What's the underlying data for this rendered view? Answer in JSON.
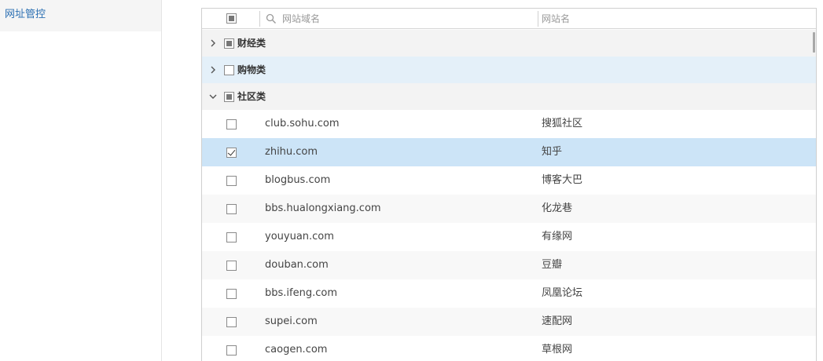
{
  "sidebar": {
    "items": [
      {
        "label": "网址管控"
      }
    ]
  },
  "table": {
    "columns": {
      "domain_placeholder": "网站域名",
      "name_header": "网站名"
    },
    "groups": [
      {
        "name": "财经类",
        "expanded": false,
        "check_state": "partial"
      },
      {
        "name": "购物类",
        "expanded": false,
        "check_state": "unchecked"
      },
      {
        "name": "社区类",
        "expanded": true,
        "check_state": "partial"
      }
    ],
    "rows": [
      {
        "domain": "club.sohu.com",
        "name": "搜狐社区",
        "checked": false
      },
      {
        "domain": "zhihu.com",
        "name": "知乎",
        "checked": true
      },
      {
        "domain": "blogbus.com",
        "name": "博客大巴",
        "checked": false
      },
      {
        "domain": "bbs.hualongxiang.com",
        "name": "化龙巷",
        "checked": false
      },
      {
        "domain": "youyuan.com",
        "name": "有缘网",
        "checked": false
      },
      {
        "domain": "douban.com",
        "name": "豆瓣",
        "checked": false
      },
      {
        "domain": "bbs.ifeng.com",
        "name": "凤凰论坛",
        "checked": false
      },
      {
        "domain": "supei.com",
        "name": "速配网",
        "checked": false
      },
      {
        "domain": "caogen.com",
        "name": "草根网",
        "checked": false
      }
    ]
  },
  "colors": {
    "accent": "#2a6fb2",
    "selected_row": "#cce4f7",
    "hover_group": "#e4f0f9"
  }
}
